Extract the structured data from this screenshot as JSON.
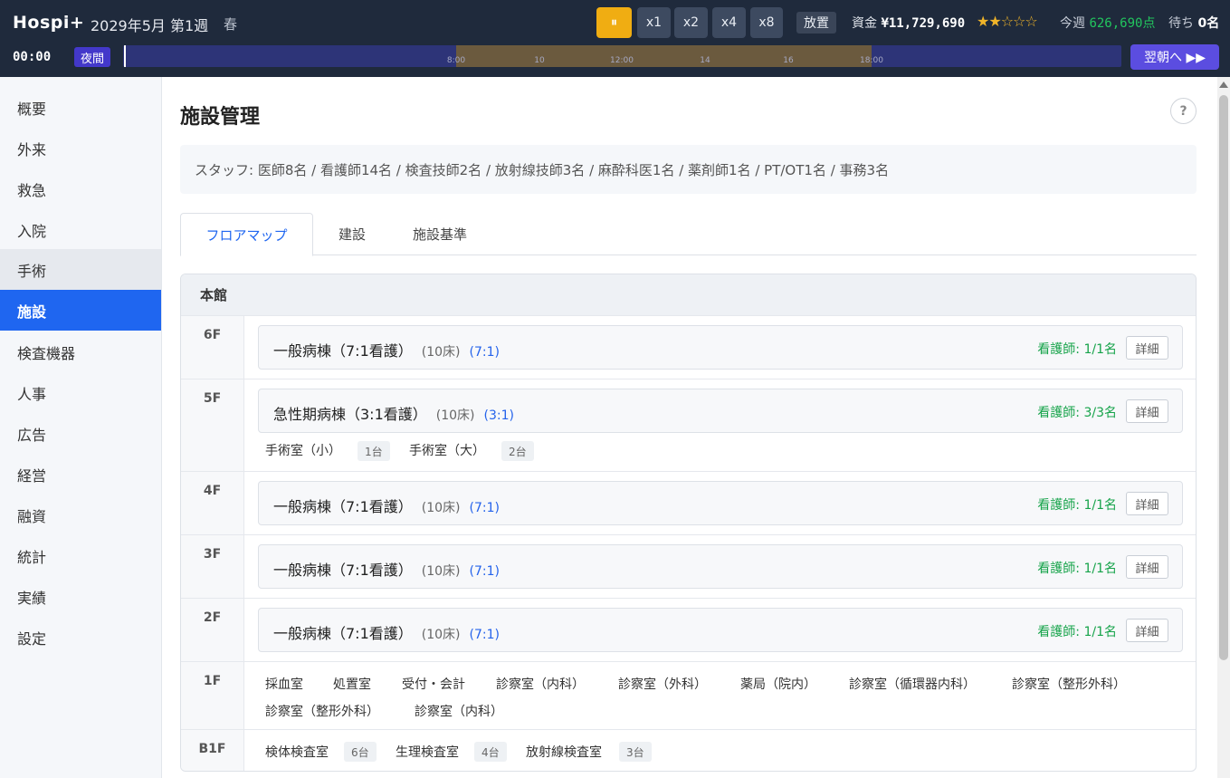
{
  "header": {
    "brand": "Hospi+",
    "date": "2029年5月 第1週",
    "season": "春",
    "pause_label": "⏸",
    "speeds": [
      "x1",
      "x2",
      "x4",
      "x8"
    ],
    "idle_label": "放置",
    "funds_label": "資金",
    "funds_value": "¥11,729,690",
    "stars_on": "★★",
    "stars_off": "☆☆☆",
    "weekly_label": "今週",
    "weekly_value": "626,690点",
    "waiting_label": "待ち",
    "waiting_value": "0名",
    "clock": "00:00",
    "phase": "夜間",
    "timeline_ticks": [
      "8:00",
      "10",
      "12:00",
      "14",
      "16",
      "18:00"
    ],
    "next_morning": "翌朝へ ▶▶"
  },
  "sidebar": {
    "items": [
      "概要",
      "外来",
      "救急",
      "入院",
      "手術",
      "施設",
      "検査機器",
      "人事",
      "広告",
      "経営",
      "融資",
      "統計",
      "実績",
      "設定"
    ]
  },
  "main": {
    "title": "施設管理",
    "help": "?",
    "staff": "スタッフ: 医師8名 / 看護師14名 / 検査技師2名 / 放射線技師3名 / 麻酔科医1名 / 薬剤師1名 / PT/OT1名 / 事務3名",
    "tabs": [
      "フロアマップ",
      "建設",
      "施設基準"
    ],
    "building": "本館",
    "detail_label": "詳細",
    "floors": {
      "f6": {
        "label": "6F",
        "ward": "一般病棟（7:1看護）",
        "beds": "(10床)",
        "ratio": "(7:1)",
        "nurses": "看護師: 1/1名"
      },
      "f5": {
        "label": "5F",
        "ward": "急性期病棟（3:1看護）",
        "beds": "(10床)",
        "ratio": "(3:1)",
        "nurses": "看護師: 3/3名",
        "rooms": [
          {
            "name": "手術室（小）",
            "count": "1台"
          },
          {
            "name": "手術室（大）",
            "count": "2台"
          }
        ]
      },
      "f4": {
        "label": "4F",
        "ward": "一般病棟（7:1看護）",
        "beds": "(10床)",
        "ratio": "(7:1)",
        "nurses": "看護師: 1/1名"
      },
      "f3": {
        "label": "3F",
        "ward": "一般病棟（7:1看護）",
        "beds": "(10床)",
        "ratio": "(7:1)",
        "nurses": "看護師: 1/1名"
      },
      "f2": {
        "label": "2F",
        "ward": "一般病棟（7:1看護）",
        "beds": "(10床)",
        "ratio": "(7:1)",
        "nurses": "看護師: 1/1名"
      },
      "f1": {
        "label": "1F",
        "rooms": [
          "採血室",
          "処置室",
          "受付・会計",
          "診察室（内科）",
          "診察室（外科）",
          "薬局（院内）",
          "診察室（循環器内科）",
          "診察室（整形外科）",
          "診察室（整形外科）",
          "診察室（内科）"
        ]
      },
      "b1": {
        "label": "B1F",
        "rooms": [
          {
            "name": "検体検査室",
            "count": "6台"
          },
          {
            "name": "生理検査室",
            "count": "4台"
          },
          {
            "name": "放射線検査室",
            "count": "3台"
          }
        ]
      }
    }
  },
  "colors": {
    "accent": "#1f66f0",
    "topbar": "#1f2a3c",
    "pause": "#f0ad12",
    "next": "#5b4de0",
    "nurses": "#16a34a",
    "ratio": "#2563eb"
  }
}
